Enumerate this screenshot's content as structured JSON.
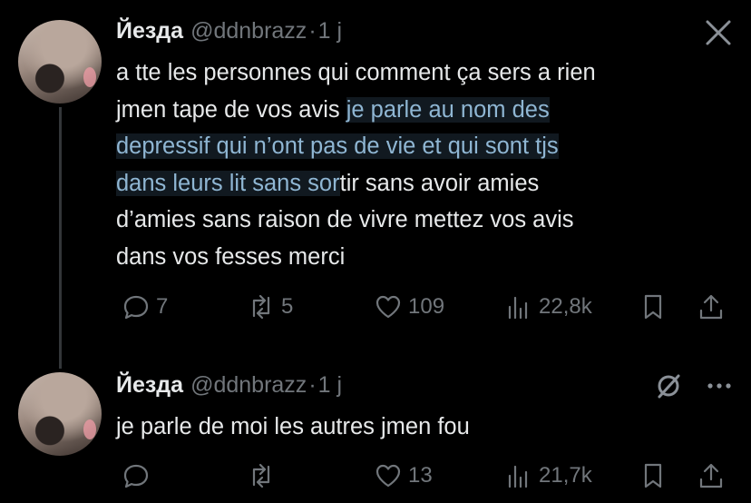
{
  "tweet1": {
    "name": "Йезда",
    "handle": "@ddnbrazz",
    "dot": "·",
    "time": "1 j",
    "text_line1": "a tte les personnes qui comment ça sers a rien",
    "text_line2_plain": "jmen tape de vos avis ",
    "text_line2_hl": "je parle au nom des",
    "text_line3_hl": "depressif qui n’ont pas de vie et qui sont tjs",
    "text_line4_hl": "dans leurs lit sans sor",
    "text_line4_plain": "tir sans avoir amies",
    "text_line5": "d’amies sans raison de vivre mettez vos avis",
    "text_line6": "dans vos fesses merci",
    "replies": "7",
    "reposts": "5",
    "likes": "109",
    "views": "22,8k"
  },
  "tweet2": {
    "name": "Йезда",
    "handle": "@ddnbrazz",
    "dot": "·",
    "time": "1 j",
    "text": "je parle de moi les autres jmen fou",
    "replies": "",
    "reposts": "",
    "likes": "13",
    "views": "21,7k"
  },
  "icons": {
    "close": "x-close-icon",
    "mute": "mute-icon",
    "more": "more-icon",
    "reply": "reply-icon",
    "repost": "repost-icon",
    "like": "heart-icon",
    "views": "views-icon",
    "bookmark": "bookmark-icon",
    "share": "share-icon"
  },
  "colors": {
    "background": "#000000",
    "text": "#e7e9ea",
    "secondary": "#71767b",
    "highlight_text": "#8fb6d3"
  }
}
